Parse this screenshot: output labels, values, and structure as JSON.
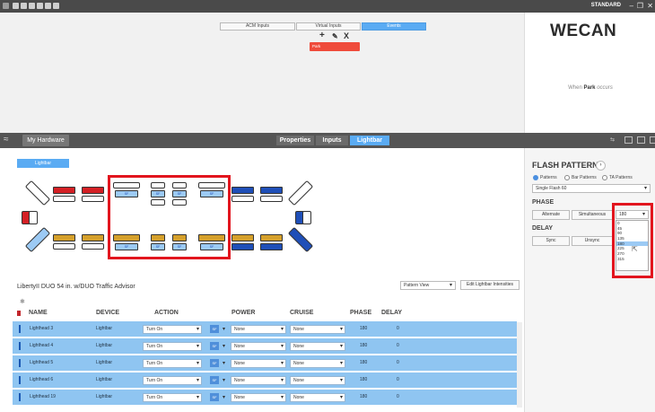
{
  "titlebar": {
    "mode": "STANDARD",
    "min": "–",
    "restore": "❐",
    "close": "✕"
  },
  "top": {
    "tabs": [
      "ACM Inputs",
      "Virtual Inputs",
      "Events"
    ],
    "active_tab": "Events",
    "tools": {
      "add": "+",
      "edit": "✎",
      "delete": "X"
    },
    "event_item": "Park"
  },
  "logo": {
    "text": "WECAN"
  },
  "when": {
    "prefix": "When",
    "event": "Park",
    "suffix": "occurs"
  },
  "strip": {
    "collapse": "≈",
    "my_hardware": "My Hardware",
    "tabs": [
      "Properties",
      "Inputs",
      "Lightbar"
    ],
    "active": "Lightbar"
  },
  "lightbar": {
    "tab": "Lightbar",
    "segment_label": "SF"
  },
  "device": {
    "name": "LibertyII DUO 54 in. w/DUO Traffic Advisor",
    "view": "Pattern View",
    "edit": "Edit Lightbar Intensities"
  },
  "table": {
    "headers": [
      "NAME",
      "DEVICE",
      "ACTION",
      "POWER",
      "CRUISE",
      "PHASE",
      "DELAY"
    ],
    "rows": [
      {
        "name": "Lighthead 3",
        "device": "Lightbar",
        "action": "Turn On",
        "sf": "SF",
        "power": "None",
        "cruise": "None",
        "phase": "180",
        "delay": "0"
      },
      {
        "name": "Lighthead 4",
        "device": "Lightbar",
        "action": "Turn On",
        "sf": "SF",
        "power": "None",
        "cruise": "None",
        "phase": "180",
        "delay": "0"
      },
      {
        "name": "Lighthead 5",
        "device": "Lightbar",
        "action": "Turn On",
        "sf": "SF",
        "power": "None",
        "cruise": "None",
        "phase": "180",
        "delay": "0"
      },
      {
        "name": "Lighthead 6",
        "device": "Lightbar",
        "action": "Turn On",
        "sf": "SF",
        "power": "None",
        "cruise": "None",
        "phase": "180",
        "delay": "0"
      },
      {
        "name": "Lighthead 19",
        "device": "Lightbar",
        "action": "Turn On",
        "sf": "SF",
        "power": "None",
        "cruise": "None",
        "phase": "180",
        "delay": "0"
      }
    ]
  },
  "panel": {
    "title": "FLASH PATTERN",
    "radios": [
      "Patterns",
      "Bar Patterns",
      "TA Patterns"
    ],
    "pattern": "Single Flash 60",
    "phase_label": "PHASE",
    "alternate": "Alternate",
    "simultaneous": "Simultaneous",
    "phase_value": "180",
    "delay_label": "DELAY",
    "sync": "Sync",
    "unsync": "Unsync",
    "phase_options": [
      "0",
      "45",
      "90",
      "135",
      "180",
      "225",
      "270",
      "315"
    ],
    "selected_option": "180"
  }
}
